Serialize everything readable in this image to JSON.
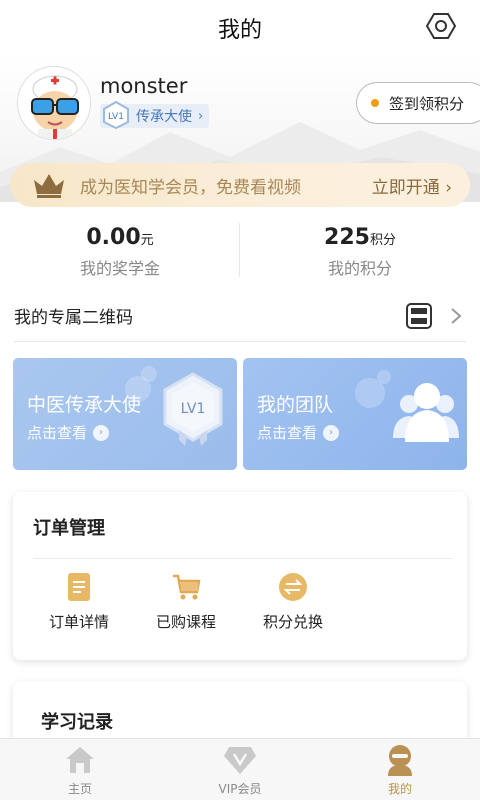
{
  "header": {
    "title": "我的"
  },
  "profile": {
    "username": "monster",
    "level_badge": "LV1",
    "level_name": "传承大使",
    "level_arrow": "›"
  },
  "signin": {
    "label": "签到领积分"
  },
  "vip_banner": {
    "text": "成为医知学会员，免费看视频",
    "action": "立即开通 ›"
  },
  "stats": [
    {
      "value": "0.00",
      "unit": "元",
      "label": "我的奖学金"
    },
    {
      "value": "225",
      "unit": "积分",
      "label": "我的积分"
    }
  ],
  "qr_row": {
    "label": "我的专属二维码"
  },
  "cards": [
    {
      "title": "中医传承大使",
      "link": "点击查看",
      "badge": "LV1"
    },
    {
      "title": "我的团队",
      "link": "点击查看"
    }
  ],
  "orders": {
    "title": "订单管理",
    "items": [
      {
        "label": "订单详情",
        "icon": "order-detail-icon"
      },
      {
        "label": "已购课程",
        "icon": "cart-icon"
      },
      {
        "label": "积分兑换",
        "icon": "exchange-icon"
      }
    ]
  },
  "study": {
    "title": "学习记录"
  },
  "tabbar": {
    "items": [
      {
        "label": "主页",
        "icon": "home-icon",
        "active": false
      },
      {
        "label": "VIP会员",
        "icon": "vip-icon",
        "active": false
      },
      {
        "label": "我的",
        "icon": "profile-icon",
        "active": true
      }
    ]
  },
  "colors": {
    "accent_gold": "#b99153",
    "card_blue": "#9bbcec",
    "level_blue": "#4a78b8",
    "signin_dot": "#f39c12"
  }
}
